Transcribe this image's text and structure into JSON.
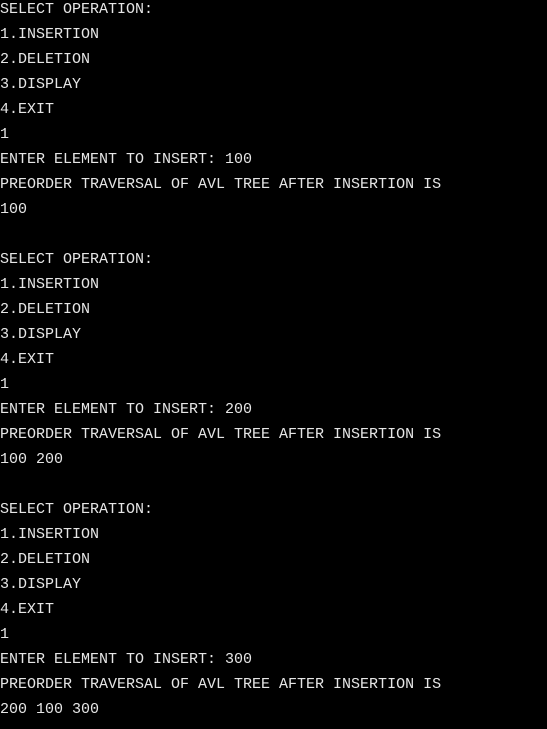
{
  "colors": {
    "background": "#000000",
    "foreground": "#e6e6e6"
  },
  "lines": [
    "SELECT OPERATION:",
    "1.INSERTION",
    "2.DELETION",
    "3.DISPLAY",
    "4.EXIT",
    "1",
    "ENTER ELEMENT TO INSERT: 100",
    "PREORDER TRAVERSAL OF AVL TREE AFTER INSERTION IS",
    "100",
    "",
    "SELECT OPERATION:",
    "1.INSERTION",
    "2.DELETION",
    "3.DISPLAY",
    "4.EXIT",
    "1",
    "ENTER ELEMENT TO INSERT: 200",
    "PREORDER TRAVERSAL OF AVL TREE AFTER INSERTION IS",
    "100 200",
    "",
    "SELECT OPERATION:",
    "1.INSERTION",
    "2.DELETION",
    "3.DISPLAY",
    "4.EXIT",
    "1",
    "ENTER ELEMENT TO INSERT: 300",
    "PREORDER TRAVERSAL OF AVL TREE AFTER INSERTION IS",
    "200 100 300"
  ]
}
